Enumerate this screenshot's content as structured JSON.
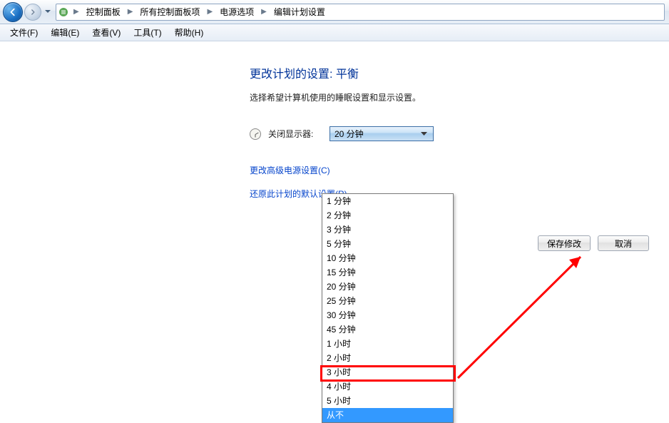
{
  "breadcrumb": {
    "items": [
      "控制面板",
      "所有控制面板项",
      "电源选项",
      "编辑计划设置"
    ]
  },
  "menu": {
    "file": "文件(F)",
    "edit": "编辑(E)",
    "view": "查看(V)",
    "tools": "工具(T)",
    "help": "帮助(H)"
  },
  "page": {
    "title": "更改计划的设置: 平衡",
    "desc": "选择希望计算机使用的睡眠设置和显示设置。",
    "display_off_label": "关闭显示器:",
    "advanced_link": "更改高级电源设置(C)",
    "restore_link": "还原此计划的默认设置(R)"
  },
  "dropdown": {
    "current": "20 分钟",
    "options": [
      "1 分钟",
      "2 分钟",
      "3 分钟",
      "5 分钟",
      "10 分钟",
      "15 分钟",
      "20 分钟",
      "25 分钟",
      "30 分钟",
      "45 分钟",
      "1 小时",
      "2 小时",
      "3 小时",
      "4 小时",
      "5 小时",
      "从不"
    ],
    "selected_index": 15
  },
  "buttons": {
    "save": "保存修改",
    "cancel": "取消"
  }
}
